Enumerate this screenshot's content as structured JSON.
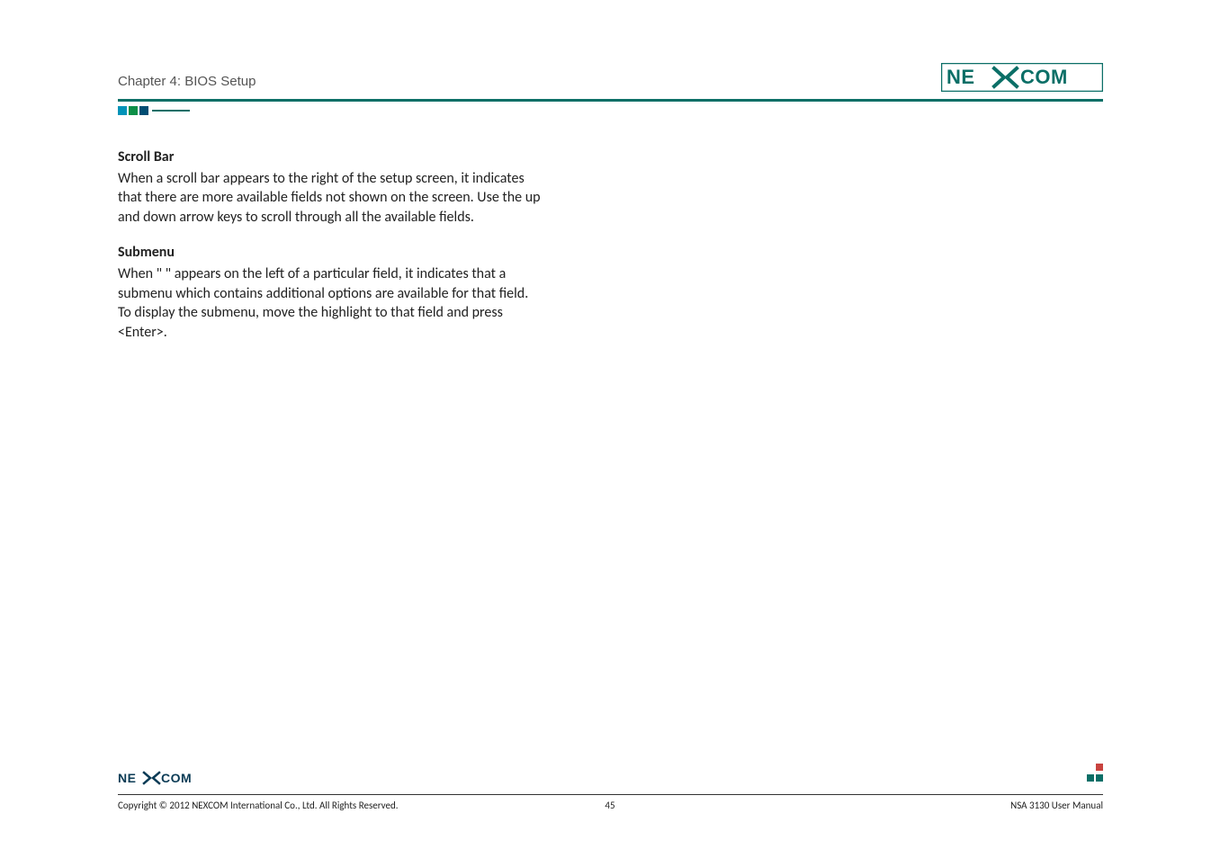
{
  "header": {
    "chapter": "Chapter 4: BIOS Setup",
    "brand_pre": "NE",
    "brand_post": "COM"
  },
  "content": {
    "section1": {
      "title": "Scroll Bar",
      "body": "When a scroll bar appears to the right of the setup screen, it indicates that there are more available fields not shown on the screen. Use the up and down arrow keys to scroll through all the available fields."
    },
    "section2": {
      "title": "Submenu",
      "body": "When \"    \" appears on the left of a particular field, it indicates that a submenu which contains additional options are available for that field. To display the submenu, move the highlight to that field and press <Enter>."
    }
  },
  "footer": {
    "copyright": "Copyright © 2012 NEXCOM International Co., Ltd. All Rights Reserved.",
    "page_number": "45",
    "manual_name": "NSA 3130 User Manual",
    "brand_pre": "NE",
    "brand_post": "COM"
  },
  "colors": {
    "brand_teal": "#0b6f67",
    "brand_dark": "#0b3b55"
  }
}
